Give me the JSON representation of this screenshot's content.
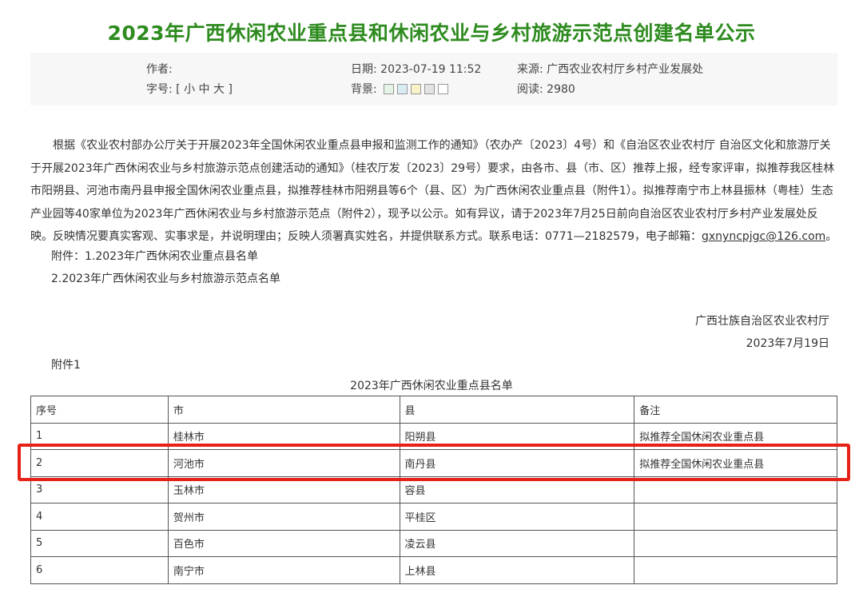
{
  "article": {
    "title": "2023年广西休闲农业重点县和休闲农业与乡村旅游示范点创建名单公示",
    "meta": {
      "author_label": "作者:",
      "date_label": "日期:",
      "date_value": "2023-07-19 11:52",
      "source_label": "来源:",
      "source_value": "广西农业农村厅乡村产业发展处",
      "font_size_label": "字号:",
      "font_size_open": "[",
      "font_small": "小",
      "font_medium": "中",
      "font_large": "大",
      "font_size_close": "]",
      "background_label": "背景:",
      "background_colors": [
        "#e6f4e6",
        "#d9ecf2",
        "#f7f3c6",
        "#e3e3e3",
        "#ffffff"
      ],
      "reads_label": "阅读:",
      "reads_value": "2980"
    },
    "paragraph_main": "根据《农业农村部办公厅关于开展2023年全国休闲农业重点县申报和监测工作的通知》（农办产〔2023〕4号）和《自治区农业农村厅 自治区文化和旅游厅关于开展2023年广西休闲农业与乡村旅游示范点创建活动的通知》（桂农厅发〔2023〕29号）要求，由各市、县（市、区）推荐上报，经专家评审，拟推荐我区桂林市阳朔县、河池市南丹县申报全国休闲农业重点县，拟推荐桂林市阳朔县等6个（县、区）为广西休闲农业重点县（附件1）。拟推荐南宁市上林县振林（粤桂）生态产业园等40家单位为2023年广西休闲农业与乡村旅游示范点（附件2），现予以公示。如有异议，请于2023年7月25日前向自治区农业农村厅乡村产业发展处反映。反映情况要真实客观、实事求是，并说明理由；反映人须署真实姓名，并提供联系方式。联系电话：0771—2182579，电子邮箱：",
    "email": "gxnyncpjgc@126.com",
    "paragraph_end": "。",
    "attachment_1": "附件：1.2023年广西休闲农业重点县名单",
    "attachment_2": "2.2023年广西休闲农业与乡村旅游示范点名单",
    "sign_org": "广西壮族自治区农业农村厅",
    "sign_date": "2023年7月19日",
    "annex_label": "附件1",
    "table_title": "2023年广西休闲农业重点县名单",
    "table": {
      "headers": [
        "序号",
        "市",
        "县",
        "备注"
      ],
      "rows": [
        [
          "1",
          "桂林市",
          "阳朔县",
          "拟推荐全国休闲农业重点县"
        ],
        [
          "2",
          "河池市",
          "南丹县",
          "拟推荐全国休闲农业重点县"
        ],
        [
          "3",
          "玉林市",
          "容县",
          ""
        ],
        [
          "4",
          "贺州市",
          "平桂区",
          ""
        ],
        [
          "5",
          "百色市",
          "凌云县",
          ""
        ],
        [
          "6",
          "南宁市",
          "上林县",
          ""
        ]
      ]
    },
    "highlight_color": "#e62117"
  }
}
